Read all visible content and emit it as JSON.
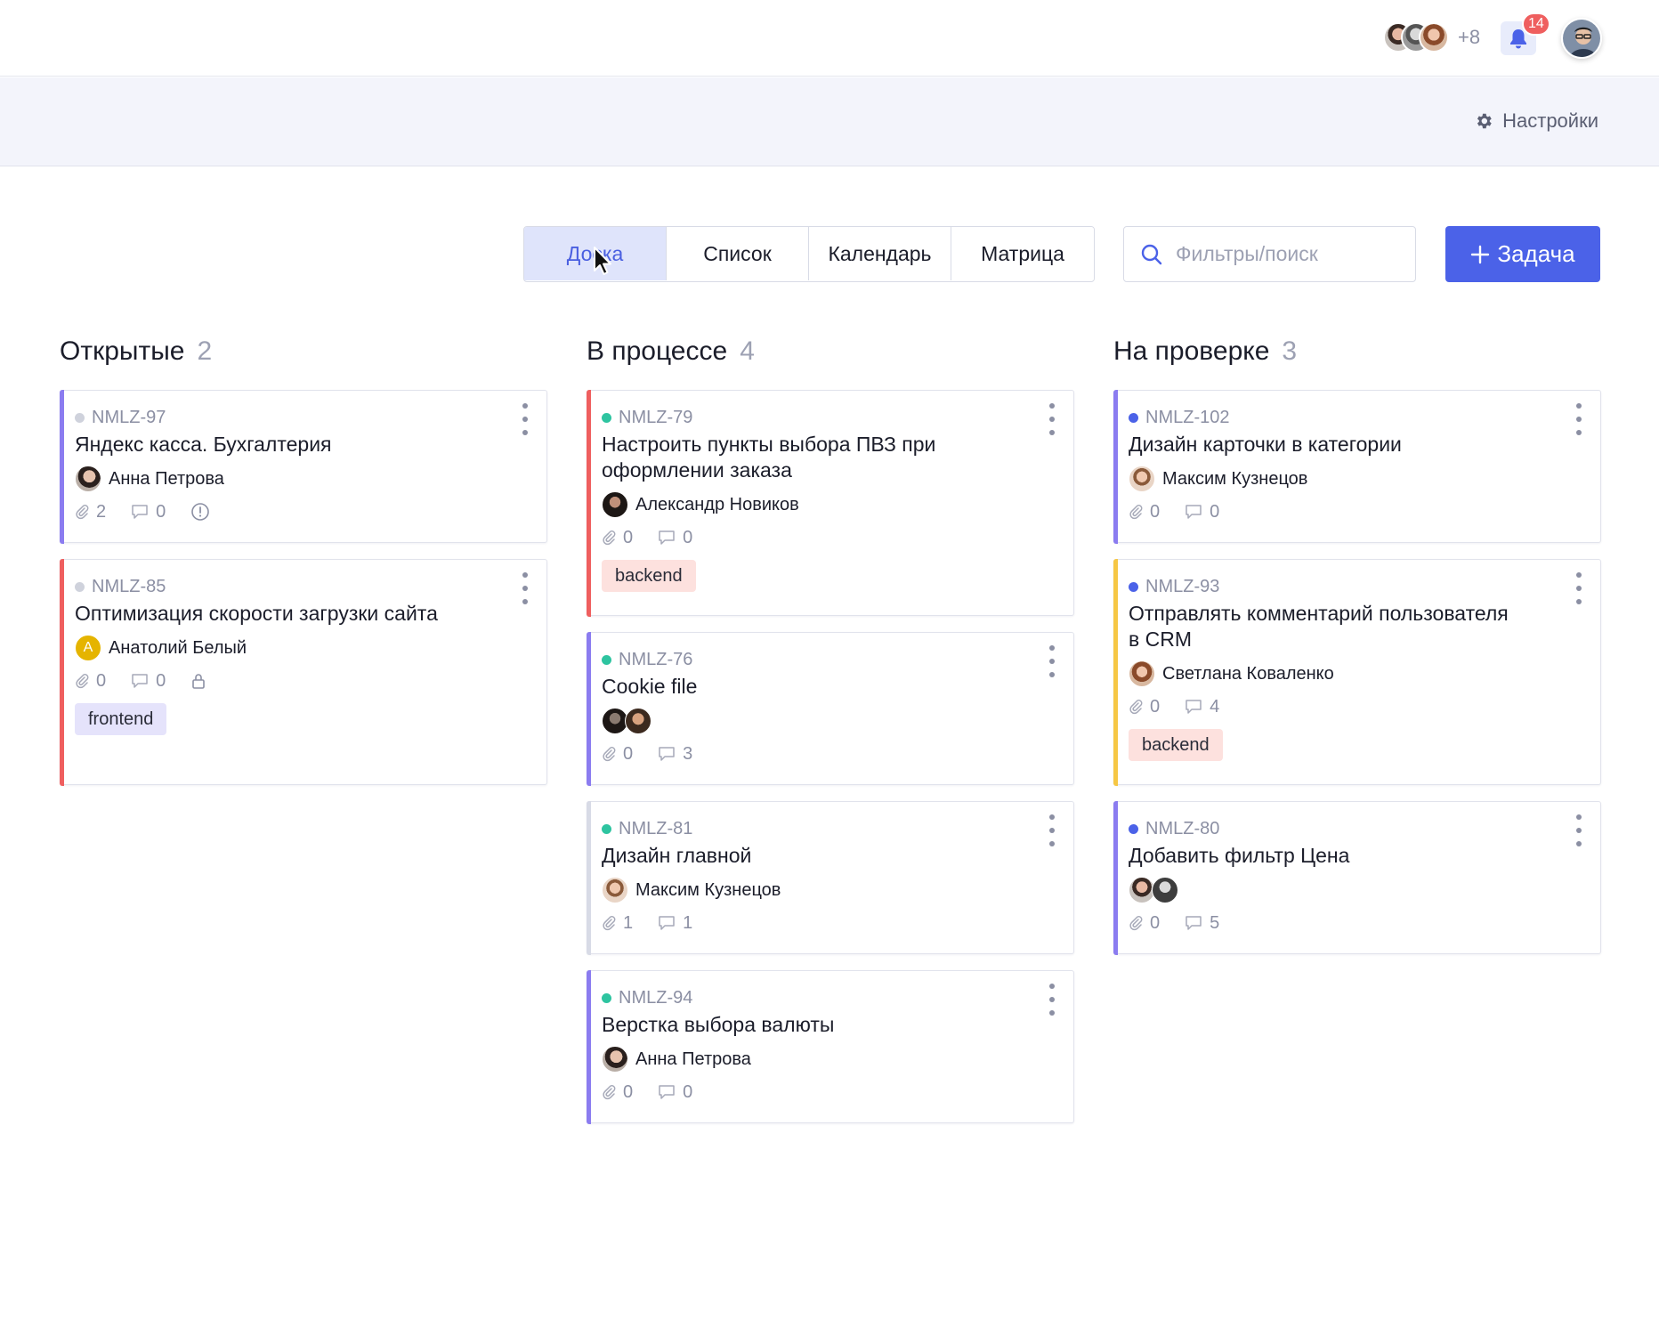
{
  "header": {
    "extra_members": "+8",
    "notifications_count": "14",
    "settings_label": "Настройки"
  },
  "views": {
    "tabs": [
      {
        "label": "Доска",
        "active": true
      },
      {
        "label": "Список",
        "active": false
      },
      {
        "label": "Календарь",
        "active": false
      },
      {
        "label": "Матрица",
        "active": false
      }
    ],
    "search_placeholder": "Фильтры/поиск",
    "add_label": "Задача"
  },
  "colors": {
    "accent": "#4b62e8",
    "status_open": "#cfd2dc",
    "status_progress": "#2ec4a0",
    "status_review": "#4b62e8",
    "stripe_purple": "#8b7cf0",
    "stripe_red": "#ef5f5f",
    "stripe_yellow": "#f6c744",
    "stripe_gray": "#d8dbe6"
  },
  "columns": [
    {
      "title": "Открытые",
      "count": "2",
      "cards": [
        {
          "code": "NMLZ-97",
          "title": "Яндекс касса. Бухгалтерия",
          "assignee": "Анна Петрова",
          "attachments": "2",
          "comments": "0",
          "extra_icon": "alert-icon",
          "tag": ""
        },
        {
          "code": "NMLZ-85",
          "title": "Оптимизация скорости загрузки сайта",
          "assignee": "Анатолий Белый",
          "assignee_initial": "А",
          "attachments": "0",
          "comments": "0",
          "extra_icon": "lock-icon",
          "tag": "frontend"
        }
      ]
    },
    {
      "title": "В процессе",
      "count": "4",
      "cards": [
        {
          "code": "NMLZ-79",
          "title": "Настроить пункты выбора ПВЗ при оформлении заказа",
          "assignee": "Александр Новиков",
          "attachments": "0",
          "comments": "0",
          "tag": "backend"
        },
        {
          "code": "NMLZ-76",
          "title": "Cookie file",
          "assignee": "",
          "attachments": "0",
          "comments": "3",
          "tag": ""
        },
        {
          "code": "NMLZ-81",
          "title": "Дизайн главной",
          "assignee": "Максим Кузнецов",
          "attachments": "1",
          "comments": "1",
          "tag": ""
        },
        {
          "code": "NMLZ-94",
          "title": "Верстка выбора валюты",
          "assignee": "Анна Петрова",
          "attachments": "0",
          "comments": "0",
          "tag": ""
        }
      ]
    },
    {
      "title": "На проверке",
      "count": "3",
      "cards": [
        {
          "code": "NMLZ-102",
          "title": "Дизайн карточки в категории",
          "assignee": "Максим Кузнецов",
          "attachments": "0",
          "comments": "0",
          "tag": ""
        },
        {
          "code": "NMLZ-93",
          "title": "Отправлять комментарий пользователя в CRM",
          "assignee": "Светлана Коваленко",
          "attachments": "0",
          "comments": "4",
          "tag": "backend"
        },
        {
          "code": "NMLZ-80",
          "title": "Добавить фильтр Цена",
          "assignee": "",
          "attachments": "0",
          "comments": "5",
          "tag": ""
        }
      ]
    }
  ]
}
